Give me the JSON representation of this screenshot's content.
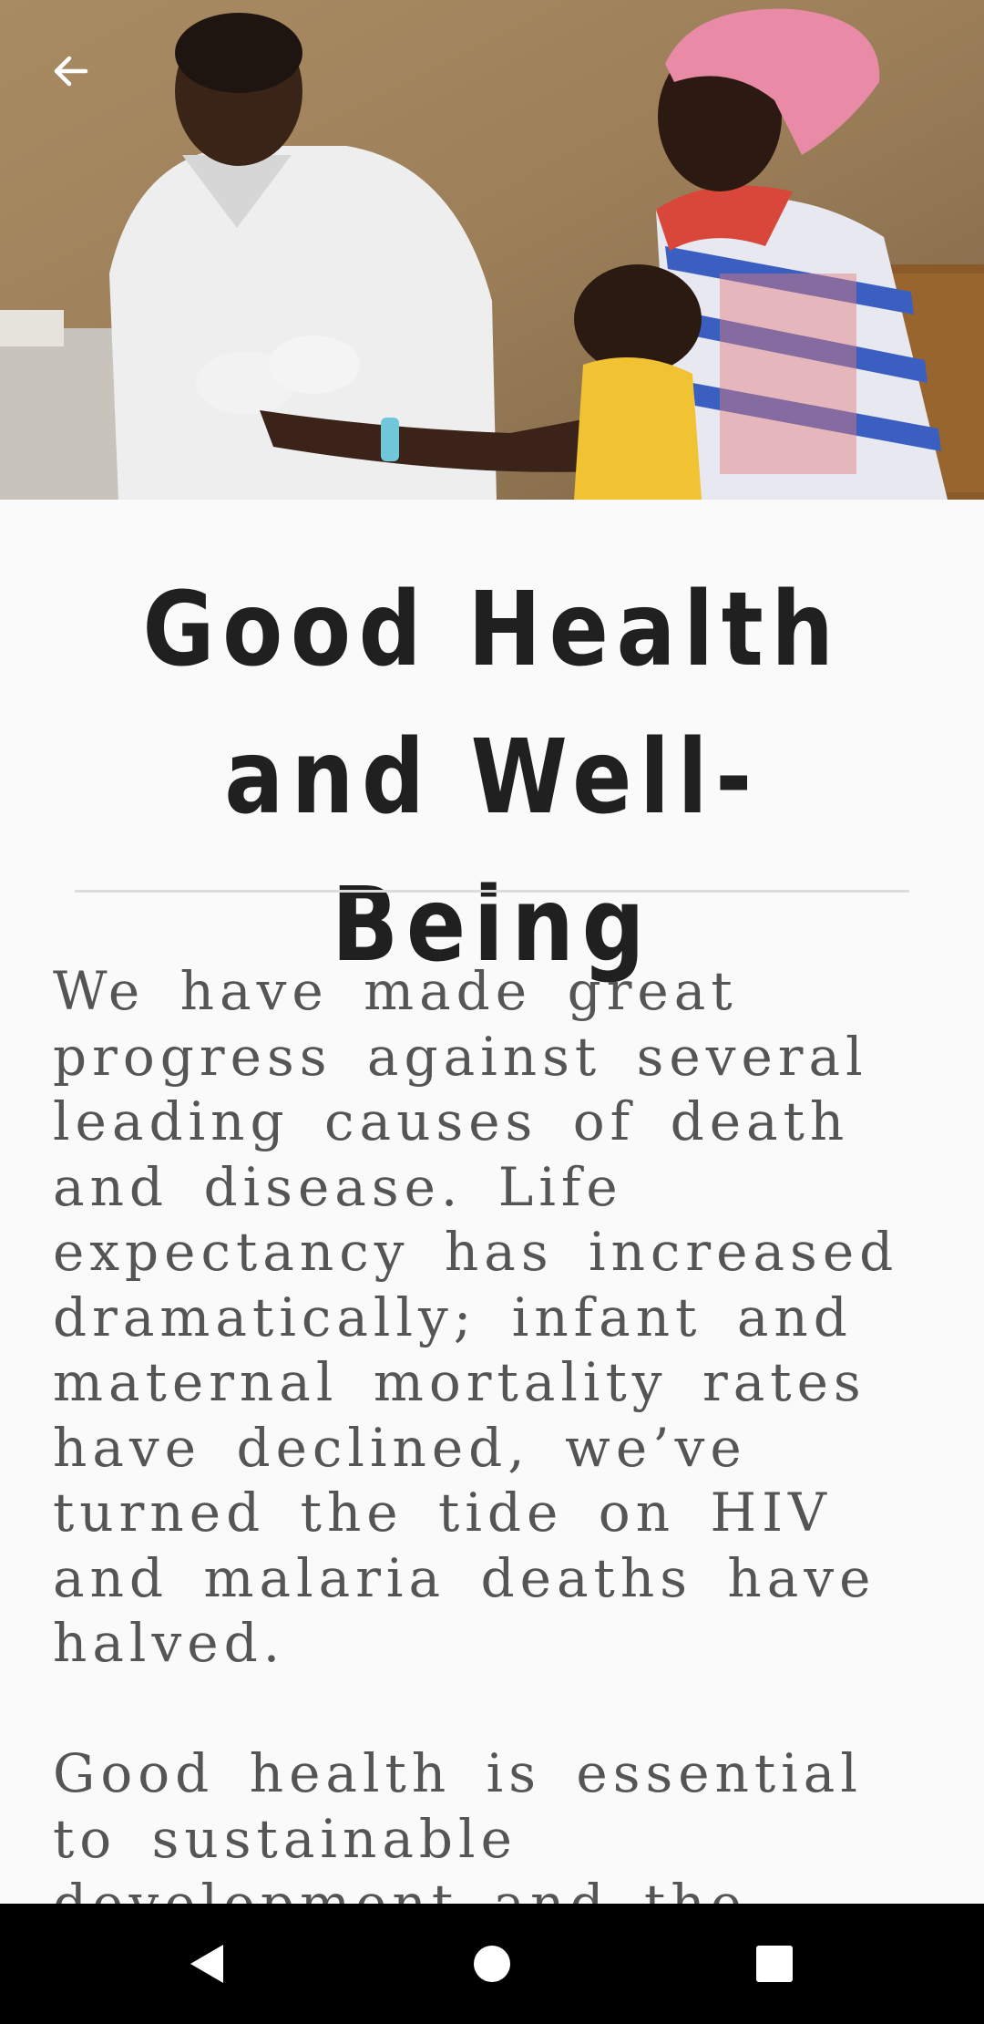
{
  "article": {
    "title": "Good Health and Well-Being",
    "paragraphs": [
      "We have made great progress against several leading causes of death and disease. Life expectancy has increased dramatically; infant and maternal mortality rates have declined, we’ve turned the tide on HIV and malaria deaths have halved.",
      "Good health is essential to sustainable development and the"
    ]
  },
  "icons": {
    "back": "back-arrow-icon",
    "nav_back": "triangle-back-icon",
    "nav_home": "circle-home-icon",
    "nav_recents": "square-recents-icon"
  },
  "colors": {
    "background": "#fafafa",
    "title": "#202020",
    "body": "#555555",
    "divider": "#dcdcdc",
    "navbar": "#000000"
  }
}
